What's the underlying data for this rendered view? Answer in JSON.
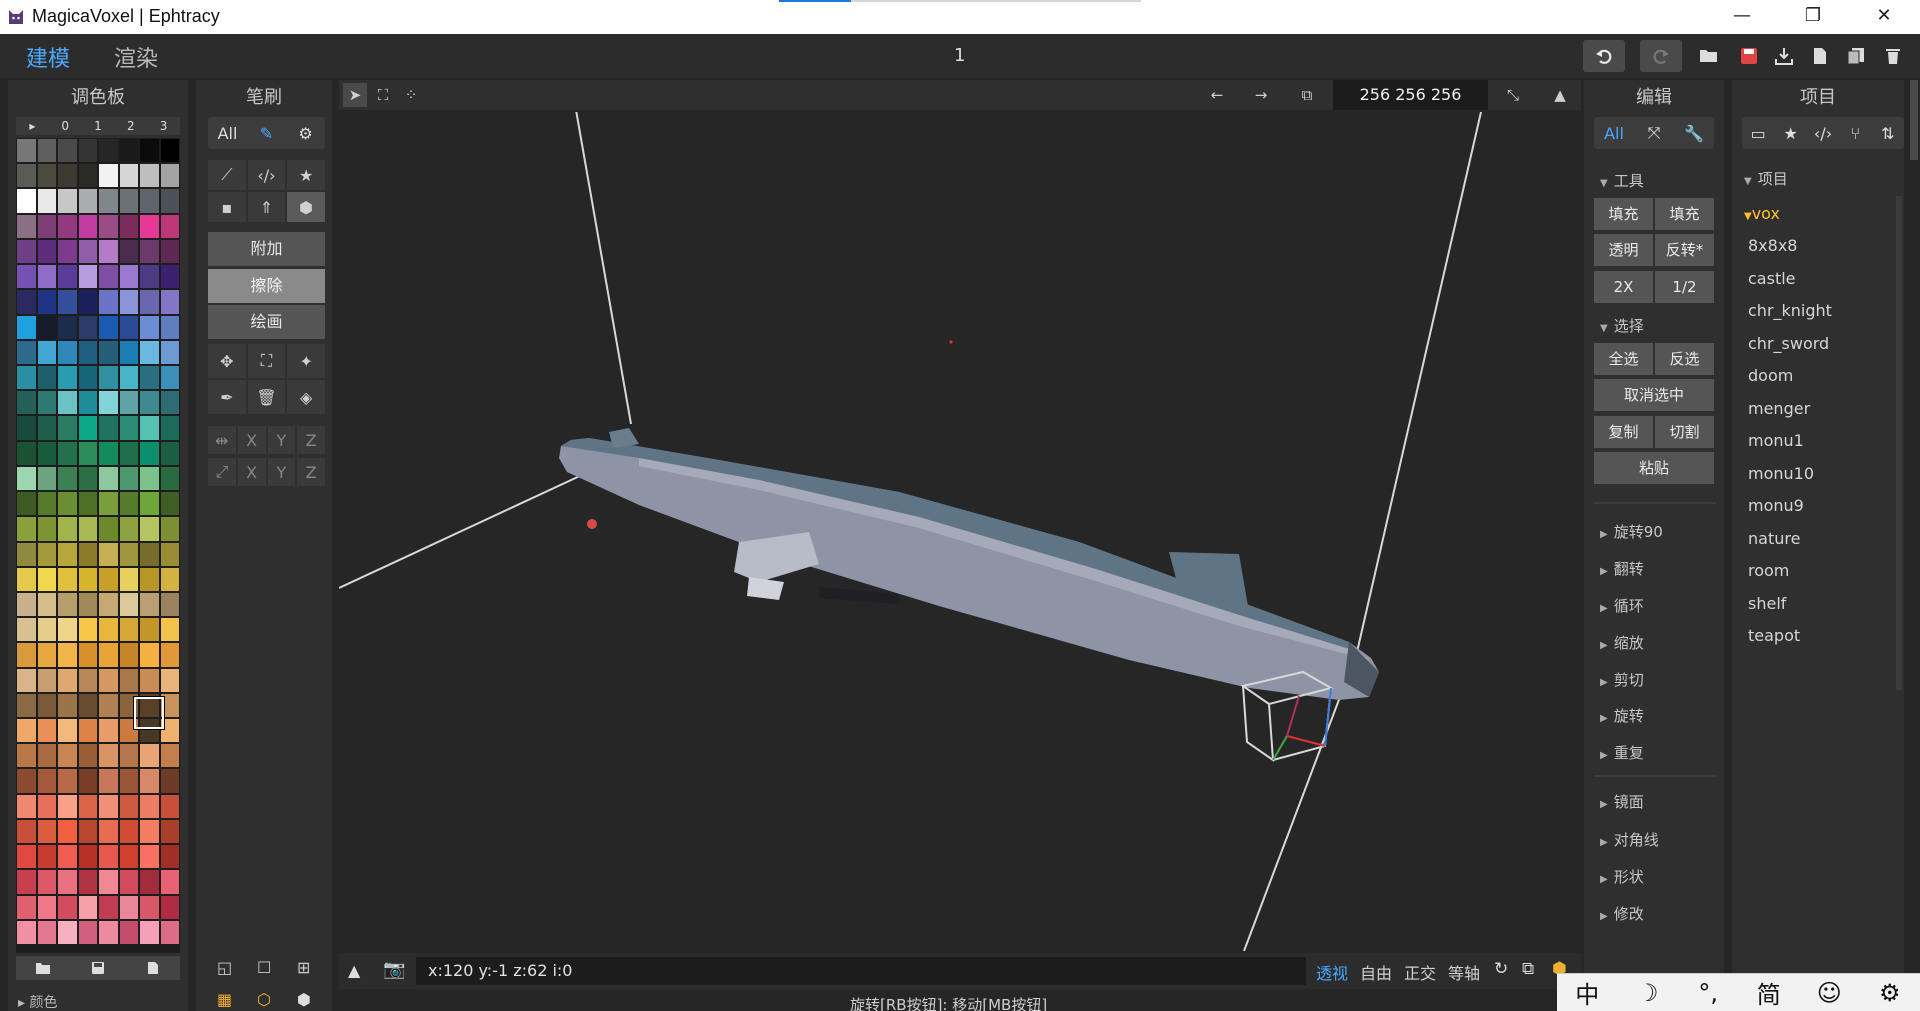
{
  "window": {
    "title": "MagicaVoxel | Ephtracy",
    "minimize": "—",
    "restore": "❐",
    "close": "✕"
  },
  "appbar": {
    "mode_model": "建模",
    "mode_render": "渲染",
    "frame": "1",
    "undo_icon": "undo-icon",
    "redo_icon": "redo-icon"
  },
  "palette": {
    "title": "调色板",
    "pages": [
      "▸",
      "0",
      "1",
      "2",
      "3"
    ],
    "section": "颜色",
    "colors": [
      "#777777",
      "#5f5f5f",
      "#4a4a4a",
      "#343434",
      "#262626",
      "#1a1a1a",
      "#0b0b0b",
      "#000000",
      "#595b55",
      "#4d4a40",
      "#3d3a34",
      "#2b2a26",
      "#f2f2f2",
      "#d6d6d6",
      "#bebebe",
      "#a3a3a3",
      "#ffffff",
      "#e9e9e9",
      "#c7c7c7",
      "#a9adb0",
      "#80878b",
      "#6b7175",
      "#5e656a",
      "#4b5156",
      "#8b6f86",
      "#7e3f78",
      "#92397f",
      "#c23ca0",
      "#9b4c86",
      "#7b2c5d",
      "#e43a95",
      "#bb3777",
      "#6e3f86",
      "#5d2d7b",
      "#7d3b8e",
      "#8f5daa",
      "#b37bc8",
      "#4a2d4e",
      "#6b3a6a",
      "#5d2953",
      "#7651b4",
      "#8e6cc8",
      "#5b3c9a",
      "#b89ce2",
      "#7e4ea4",
      "#9c79d1",
      "#4c3a85",
      "#3a2170",
      "#2a2a60",
      "#1f3486",
      "#334e9c",
      "#1b1f5e",
      "#6a73c7",
      "#8a94d8",
      "#6a66b0",
      "#8376c6",
      "#20a0e0",
      "#151b2a",
      "#1c2b4b",
      "#2b3c6a",
      "#1a5ab2",
      "#2a4c96",
      "#6c8cd4",
      "#5f7ec2",
      "#2e6a8c",
      "#42a6d4",
      "#2f86b8",
      "#1e5f82",
      "#265e78",
      "#1a7db3",
      "#69b8e2",
      "#6c9bd3",
      "#2a8fa4",
      "#1d5f6a",
      "#2a9cb0",
      "#176578",
      "#2f90a2",
      "#48b4c6",
      "#2a6e80",
      "#3b8fb8",
      "#255f5a",
      "#2c7a72",
      "#69c2c4",
      "#1e8b98",
      "#82d4da",
      "#5fa3a8",
      "#3f8a8e",
      "#2c6c72",
      "#164a3a",
      "#1f5e4a",
      "#2b7a62",
      "#0aa887",
      "#1f7260",
      "#2d8c76",
      "#54c1b1",
      "#1a6b5a",
      "#1c5234",
      "#175c3d",
      "#22714c",
      "#2c8c5c",
      "#128c5c",
      "#1f6e4c",
      "#0c8f6a",
      "#1c5e44",
      "#9bd6b0",
      "#6da37e",
      "#3d8056",
      "#2c6e46",
      "#8ec6a0",
      "#4e9870",
      "#7ac48c",
      "#2a6a40",
      "#3c5b22",
      "#547a2a",
      "#6a8f32",
      "#4e7026",
      "#789f3c",
      "#547c2c",
      "#6fa63a",
      "#3f5e24",
      "#8aa03a",
      "#7c9434",
      "#9fb44a",
      "#a8b854",
      "#6c8a2c",
      "#8ca240",
      "#b4c460",
      "#7e8f32",
      "#8f8a3e",
      "#a39a3c",
      "#b6a63c",
      "#8c7c2a",
      "#c4b052",
      "#a09640",
      "#786c2a",
      "#9a8c34",
      "#e6c84a",
      "#f2d84c",
      "#e0c03a",
      "#d6b42c",
      "#c8a028",
      "#e8d060",
      "#b89626",
      "#d4b240",
      "#c8b08a",
      "#d6be8a",
      "#b49e6c",
      "#a08a5a",
      "#c6a870",
      "#ddc89a",
      "#b8a072",
      "#9a8460",
      "#d8c090",
      "#e6cc8a",
      "#f0d48a",
      "#f6c648",
      "#e8b63c",
      "#d6a636",
      "#c49628",
      "#f2c24c",
      "#d89a3a",
      "#e6a640",
      "#f0b448",
      "#d8902a",
      "#e8a436",
      "#c88428",
      "#f6b040",
      "#e09838",
      "#d8b488",
      "#c89e70",
      "#e0a870",
      "#b88858",
      "#d49860",
      "#a8784a",
      "#c88c54",
      "#e8b47a",
      "#8a6a44",
      "#7a5a3a",
      "#9a7448",
      "#6a4c30",
      "#b08050",
      "#8c643c",
      "#5a4028",
      "#c8935a",
      "#f0a868",
      "#e89058",
      "#f4b87c",
      "#dc8448",
      "#e89c68",
      "#cc7a40",
      "#473824",
      "#f0b070",
      "#b87848",
      "#a86a40",
      "#c88654",
      "#9a5e36",
      "#d89464",
      "#b4764a",
      "#e8a474",
      "#c47e4e",
      "#8c4a30",
      "#a45a3a",
      "#b86a48",
      "#7a3e28",
      "#c87858",
      "#9a5436",
      "#d88868",
      "#6c3a26",
      "#f08870",
      "#e87058",
      "#f8a088",
      "#dc6448",
      "#f09078",
      "#d05a40",
      "#ec7c64",
      "#c8503a",
      "#c85038",
      "#dc5c40",
      "#f06040",
      "#b84830",
      "#e86c50",
      "#d04c34",
      "#f47c60",
      "#a84028",
      "#e04840",
      "#c83c30",
      "#f05c50",
      "#b83028",
      "#e8584c",
      "#d0402c",
      "#f87064",
      "#a03024",
      "#c84050",
      "#dc5866",
      "#e87080",
      "#b03444",
      "#f08894",
      "#d04c5c",
      "#a02c3c",
      "#e86274",
      "#e06070",
      "#f07888",
      "#d24c5e",
      "#f6a0ac",
      "#c03c50",
      "#e88898",
      "#d85868",
      "#b02c44",
      "#f090a4",
      "#e47890",
      "#f8b0c0",
      "#d0607c",
      "#ec8aa0",
      "#c44c6c",
      "#f4a0b8",
      "#dc6c88",
      "#ec7c98",
      "#dc5c7c",
      "#f4a4b8",
      "#c8486c",
      "#e8708e",
      "#b83860",
      "#f090ac",
      "#d45478",
      "#f0a4b4",
      "#e88ca0",
      "#f8c0cc",
      "#dc7890",
      "#f4b0c0",
      "#d06c86",
      "#fcd0d8",
      "#e494a8",
      "#e890a8",
      "#d87490",
      "#f0b0c0",
      "#c86080",
      "#f4a0b8",
      "#e08098",
      "#f8c0d0",
      "#d06888",
      "#f0a8c0",
      "#e898b0",
      "#f8c8d8",
      "#dc88a4",
      "#f4b8cc",
      "#d47c9c",
      "#fcd8e4",
      "#e8a0b8"
    ]
  },
  "brush": {
    "title": "笔刷",
    "filter_all": "All",
    "shapes": [
      "line-icon",
      "code-icon",
      "star-icon",
      "voxel-icon",
      "pin-icon",
      "cube-icon"
    ],
    "modes": [
      "附加",
      "擦除",
      "绘画"
    ],
    "tools": [
      "move-icon",
      "select-box-icon",
      "magic-wand-icon",
      "eyedropper-icon",
      "trash-icon",
      "fill-icon"
    ],
    "mirror_axes": [
      "X",
      "Y",
      "Z"
    ],
    "axis_axes": [
      "X",
      "Y",
      "Z"
    ]
  },
  "viewport": {
    "dims": "256 256 256",
    "coords": "x:120 y:-1  z:62  i:0",
    "view_modes": [
      "透视",
      "自由",
      "正交",
      "等轴"
    ],
    "hint": "旋转[RB按钮]: 移动[MB按钮]"
  },
  "edit": {
    "title": "编辑",
    "filter_all": "All",
    "tools_header": "工具",
    "tool_buttons": [
      "填充",
      "填充",
      "透明",
      "反转*",
      "2X",
      "1/2"
    ],
    "select_header": "选择",
    "select_all": "全选",
    "invert": "反选",
    "deselect": "取消选中",
    "copy": "复制",
    "cut": "切割",
    "paste": "粘贴",
    "folds1": [
      "旋转90",
      "翻转",
      "循环",
      "缩放",
      "剪切",
      "旋转",
      "重复"
    ],
    "folds2": [
      "镜面",
      "对角线",
      "形状",
      "修改"
    ]
  },
  "project": {
    "title": "项目",
    "header": "项目",
    "folder": "vox",
    "items": [
      "8x8x8",
      "castle",
      "chr_knight",
      "chr_sword",
      "doom",
      "menger",
      "monu1",
      "monu10",
      "monu9",
      "nature",
      "room",
      "shelf",
      "teapot"
    ]
  },
  "ime": [
    "中",
    "☽",
    "°,",
    "简",
    "☺",
    "⚙"
  ],
  "colors": {
    "accent": "#4aa8ff",
    "folder_active": "#ffc02a",
    "hull_top": "#5f7585",
    "hull_side": "#8f93a6"
  }
}
